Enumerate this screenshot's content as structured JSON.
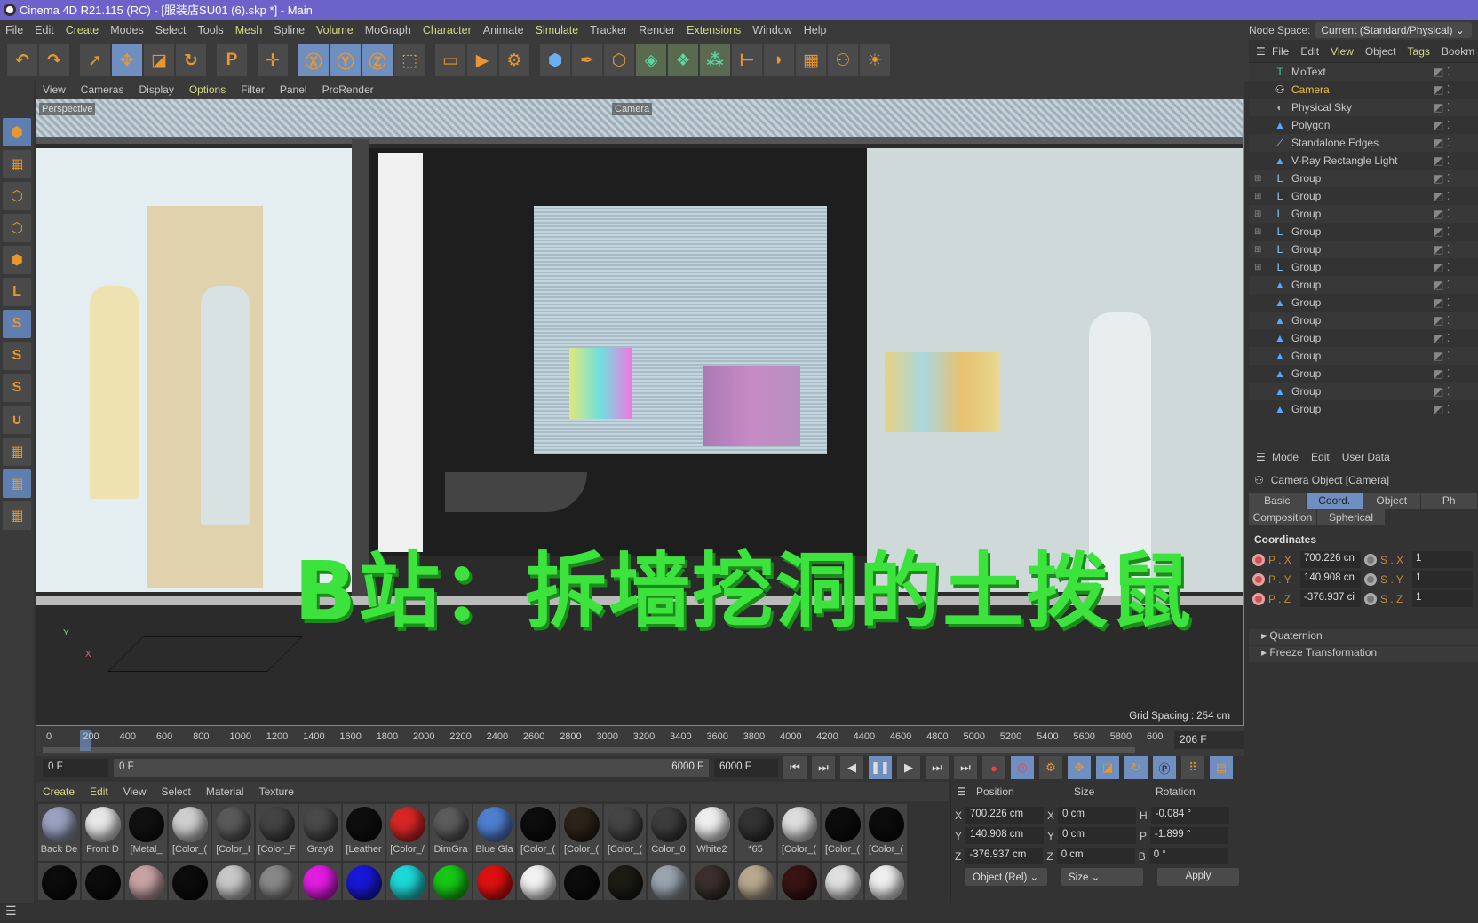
{
  "window": {
    "title": "Cinema 4D R21.115 (RC) - [服装店SU01 (6).skp *] - Main"
  },
  "menu": [
    "File",
    "Edit",
    "Create",
    "Modes",
    "Select",
    "Tools",
    "Mesh",
    "Spline",
    "Volume",
    "MoGraph",
    "Character",
    "Animate",
    "Simulate",
    "Tracker",
    "Render",
    "Extensions",
    "Window",
    "Help"
  ],
  "node_space": {
    "label": "Node Space:",
    "value": "Current (Standard/Physical)"
  },
  "toolbar": {
    "icons": [
      "undo-icon",
      "redo-icon",
      "select-icon",
      "move-icon",
      "scale-icon",
      "rotate-icon",
      "psr-icon",
      "world-axis-icon",
      "x-axis-icon",
      "y-axis-icon",
      "z-axis-icon",
      "coordinate-system-icon",
      "render-region-icon",
      "render-view-icon",
      "render-settings-icon",
      "cube-icon",
      "pen-icon",
      "subdivision-icon",
      "extrude-icon",
      "cloner-icon",
      "array-icon",
      "deformer-icon",
      "spline-icon",
      "floor-icon",
      "camera-icon",
      "light-icon"
    ]
  },
  "viewport": {
    "menu": [
      "View",
      "Cameras",
      "Display",
      "Options",
      "Filter",
      "Panel",
      "ProRender"
    ],
    "label": "Perspective",
    "camera_label": "Camera",
    "grid_spacing": "Grid Spacing : 254 cm",
    "motext": "B站：拆墙挖洞的土拨鼠",
    "axis_y": "Y",
    "axis_x": "X"
  },
  "timeline": {
    "ticks": [
      "0",
      "200",
      "400",
      "600",
      "800",
      "1000",
      "1200",
      "1400",
      "1600",
      "1800",
      "2000",
      "2200",
      "2400",
      "2600",
      "2800",
      "3000",
      "3200",
      "3400",
      "3600",
      "3800",
      "4000",
      "4200",
      "4400",
      "4600",
      "4800",
      "5000",
      "5200",
      "5400",
      "5600",
      "5800",
      "600"
    ],
    "current_frame": "206 F",
    "start": "0 F",
    "range_start": "0 F",
    "range_end": "6000 F",
    "end": "6000 F",
    "playhead_percent": 3.4
  },
  "materials": {
    "menu": [
      "Create",
      "Edit",
      "View",
      "Select",
      "Material",
      "Texture"
    ],
    "row1": [
      {
        "name": "Back De",
        "color": "#9aa2c0"
      },
      {
        "name": "Front D",
        "color": "#e8e8e8"
      },
      {
        "name": "[Metal_",
        "color": "#111"
      },
      {
        "name": "[Color_(",
        "color": "#cfcfcf"
      },
      {
        "name": "[Color_I",
        "color": "#5a5a5a"
      },
      {
        "name": "[Color_F",
        "color": "#444"
      },
      {
        "name": "Gray8",
        "color": "#4a4a4a"
      },
      {
        "name": "[Leather",
        "color": "#0e0e0e"
      },
      {
        "name": "[Color_/",
        "color": "#d82626"
      },
      {
        "name": "DimGra",
        "color": "#5c5c5c"
      },
      {
        "name": "Blue Gla",
        "color": "#4f7fd0"
      },
      {
        "name": "[Color_(",
        "color": "#0d0d0d"
      },
      {
        "name": "[Color_(",
        "color": "#2d2318"
      },
      {
        "name": "[Color_(",
        "color": "#454545"
      },
      {
        "name": "Color_0",
        "color": "#3d3d3d"
      },
      {
        "name": "White2",
        "color": "#eeeeee"
      },
      {
        "name": "*65",
        "color": "#333"
      },
      {
        "name": "[Color_(",
        "color": "#ddd"
      },
      {
        "name": "[Color_(",
        "color": "#0c0c0c"
      },
      {
        "name": "[Color_(",
        "color": "#0c0c0c"
      }
    ],
    "row2": [
      "#0c0c0c",
      "#0c0c0c",
      "#c8a3a3",
      "#0c0c0c",
      "#c8c8c8",
      "#888",
      "#e21ce2",
      "#1818d8",
      "#1ed8d8",
      "#16c816",
      "#e01010",
      "#f2f2f2",
      "#0c0c0c",
      "#1c1c14",
      "#9aa4ae",
      "#3a2e2e",
      "#b8a890",
      "#3a1414",
      "#e0e0e0",
      "#eeeeee"
    ]
  },
  "coord_manager": {
    "headers": [
      "Position",
      "Size",
      "Rotation"
    ],
    "rows": [
      {
        "pl": "X",
        "p": "700.226 cm",
        "sl": "X",
        "s": "0 cm",
        "rl": "H",
        "r": "-0.084 °"
      },
      {
        "pl": "Y",
        "p": "140.908 cm",
        "sl": "Y",
        "s": "0 cm",
        "rl": "P",
        "r": "-1.899 °"
      },
      {
        "pl": "Z",
        "p": "-376.937 cm",
        "sl": "Z",
        "s": "0 cm",
        "rl": "B",
        "r": "0 °"
      }
    ],
    "mode": "Object (Rel)",
    "size_mode": "Size",
    "apply": "Apply"
  },
  "object_manager": {
    "menu": [
      "File",
      "Edit",
      "View",
      "Object",
      "Tags",
      "Bookm"
    ],
    "objects": [
      {
        "name": "MoText",
        "icon": "motext-icon",
        "glyph": "T",
        "color": "#3c9"
      },
      {
        "name": "Camera",
        "icon": "camera-icon",
        "glyph": "⚇",
        "color": "#ddd",
        "selected": true
      },
      {
        "name": "Physical Sky",
        "icon": "sky-icon",
        "glyph": "◐",
        "color": "#9ab"
      },
      {
        "name": "Polygon",
        "icon": "polygon-icon",
        "glyph": "▲",
        "color": "#5af"
      },
      {
        "name": "Standalone Edges",
        "icon": "edges-icon",
        "glyph": "⟋",
        "color": "#9bd"
      },
      {
        "name": "V-Ray Rectangle Light",
        "icon": "polygon-icon",
        "glyph": "▲",
        "color": "#5af"
      },
      {
        "name": "Group",
        "icon": "null-group-icon",
        "glyph": "L",
        "color": "#8cf"
      },
      {
        "name": "Group",
        "icon": "null-group-icon",
        "glyph": "L",
        "color": "#8cf"
      },
      {
        "name": "Group",
        "icon": "null-group-icon",
        "glyph": "L",
        "color": "#8cf"
      },
      {
        "name": "Group",
        "icon": "null-group-icon",
        "glyph": "L",
        "color": "#8cf"
      },
      {
        "name": "Group",
        "icon": "null-group-icon",
        "glyph": "L",
        "color": "#8cf"
      },
      {
        "name": "Group",
        "icon": "null-group-icon",
        "glyph": "L",
        "color": "#8cf"
      },
      {
        "name": "Group",
        "icon": "polygon-icon",
        "glyph": "▲",
        "color": "#5af"
      },
      {
        "name": "Group",
        "icon": "polygon-icon",
        "glyph": "▲",
        "color": "#5af"
      },
      {
        "name": "Group",
        "icon": "polygon-icon",
        "glyph": "▲",
        "color": "#5af"
      },
      {
        "name": "Group",
        "icon": "polygon-icon",
        "glyph": "▲",
        "color": "#5af"
      },
      {
        "name": "Group",
        "icon": "polygon-icon",
        "glyph": "▲",
        "color": "#5af"
      },
      {
        "name": "Group",
        "icon": "polygon-icon",
        "glyph": "▲",
        "color": "#5af"
      },
      {
        "name": "Group",
        "icon": "polygon-icon",
        "glyph": "▲",
        "color": "#5af"
      },
      {
        "name": "Group",
        "icon": "polygon-icon",
        "glyph": "▲",
        "color": "#5af"
      }
    ]
  },
  "attributes": {
    "menu": [
      "Mode",
      "Edit",
      "User Data"
    ],
    "title": "Camera Object [Camera]",
    "tabs": [
      "Basic",
      "Coord.",
      "Object",
      "Ph"
    ],
    "tabs2": [
      "Composition",
      "Spherical"
    ],
    "active_tab": "Coord.",
    "section": "Coordinates",
    "rows": [
      {
        "pl": "P . X",
        "p": "700.226 cn",
        "sl": "S . X",
        "s": "1"
      },
      {
        "pl": "P . Y",
        "p": "140.908 cn",
        "sl": "S . Y",
        "s": "1"
      },
      {
        "pl": "P . Z",
        "p": "-376.937 ci",
        "sl": "S . Z",
        "s": "1"
      }
    ],
    "collapsed": [
      "Quaternion",
      "Freeze Transformation"
    ]
  },
  "colors": {
    "accent": "#6e8fc0",
    "titlebar": "#6b63c9",
    "motext": "#3de33d",
    "selected_object": "#f0c040"
  }
}
